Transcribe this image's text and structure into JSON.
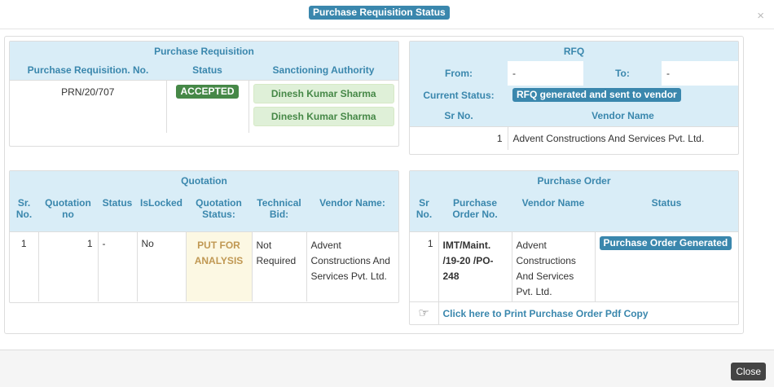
{
  "modal": {
    "title": "Purchase Requisition Status",
    "close_symbol": "×",
    "close_button_label": "Close"
  },
  "purchase_requisition": {
    "caption": "Purchase Requisition",
    "headers": [
      "Purchase Requisition. No.",
      "Status",
      "Sanctioning Authority"
    ],
    "number": "PRN/20/707",
    "status": "ACCEPTED",
    "authorities": [
      "Dinesh Kumar Sharma",
      "Dinesh Kumar Sharma"
    ]
  },
  "rfq": {
    "caption": "RFQ",
    "from_label": "From:",
    "from_value": "-",
    "to_label": "To:",
    "to_value": "-",
    "current_status_label": "Current Status:",
    "current_status_value": "RFQ generated and sent to vendor",
    "headers": [
      "Sr No.",
      "Vendor Name"
    ],
    "rows": [
      {
        "sr": "1",
        "vendor": "Advent Constructions And Services Pvt. Ltd."
      }
    ]
  },
  "quotation": {
    "caption": "Quotation",
    "headers": [
      "Sr. No.",
      "Quotation no",
      "Status",
      "IsLocked",
      "Quotation Status:",
      "Technical Bid:",
      "Vendor Name:"
    ],
    "rows": [
      {
        "sr": "1",
        "quotation_no": "1",
        "status": "-",
        "is_locked": "No",
        "quotation_status": "PUT FOR ANALYSIS",
        "technical_bid": "Not Required",
        "vendor": "Advent Constructions And Services Pvt. Ltd."
      }
    ]
  },
  "purchase_order": {
    "caption": "Purchase Order",
    "headers": [
      "Sr No.",
      "Purchase Order No.",
      "Vendor Name",
      "Status"
    ],
    "rows": [
      {
        "sr": "1",
        "po_no": "IMT/Maint. /19-20 /PO-248",
        "vendor": "Advent Constructions And Services Pvt. Ltd.",
        "status": "Purchase Order Generated"
      }
    ],
    "print_link": "Click here to Print Purchase Order Pdf Copy",
    "print_icon": "hand-pointer-icon"
  },
  "colors": {
    "info": "#3a87ad",
    "success": "#468847",
    "header_bg": "#d9edf7",
    "warning_text": "#c09853",
    "warning_bg": "#fcf8e3"
  }
}
